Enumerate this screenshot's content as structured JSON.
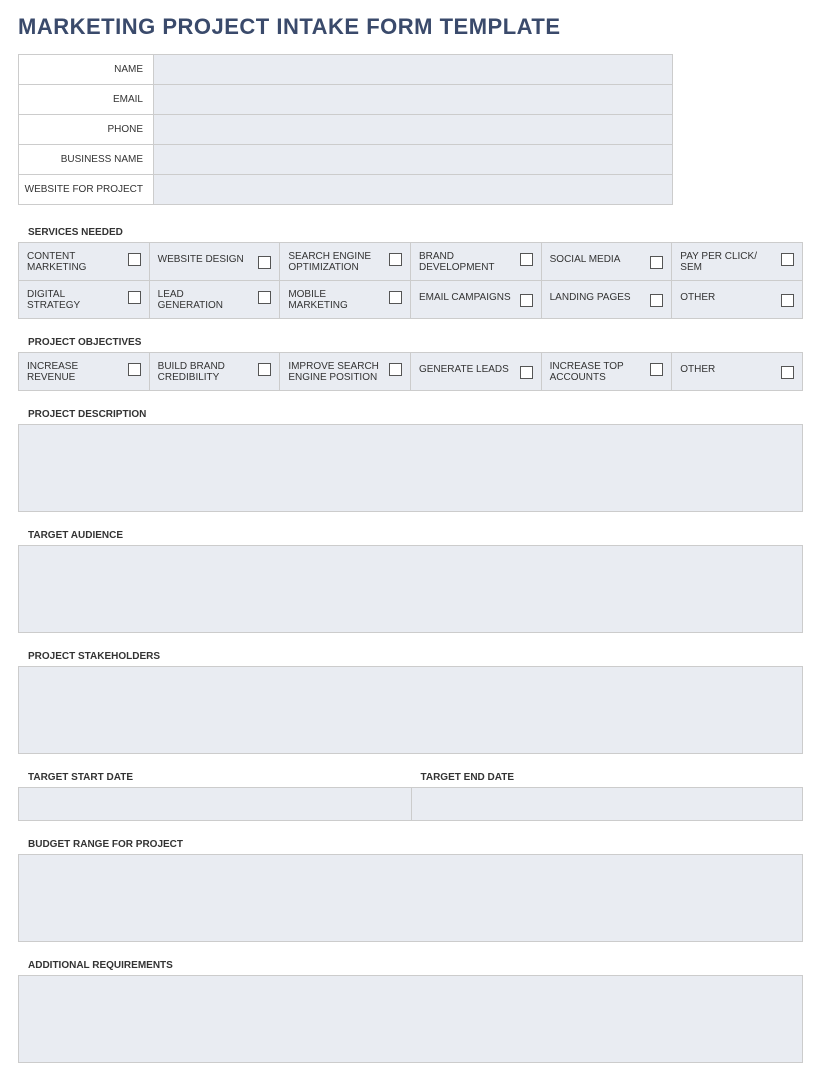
{
  "title": "MARKETING PROJECT INTAKE FORM TEMPLATE",
  "info": {
    "name": {
      "label": "NAME",
      "value": ""
    },
    "email": {
      "label": "EMAIL",
      "value": ""
    },
    "phone": {
      "label": "PHONE",
      "value": ""
    },
    "business_name": {
      "label": "BUSINESS NAME",
      "value": ""
    },
    "website": {
      "label": "WEBSITE FOR PROJECT",
      "value": ""
    }
  },
  "services": {
    "header": "SERVICES NEEDED",
    "row1": [
      "CONTENT MARKETING",
      "WEBSITE DESIGN",
      "SEARCH ENGINE OPTIMIZATION",
      "BRAND DEVELOPMENT",
      "SOCIAL MEDIA",
      "PAY PER CLICK/ SEM"
    ],
    "row2": [
      "DIGITAL STRATEGY",
      "LEAD GENERATION",
      "MOBILE MARKETING",
      "EMAIL CAMPAIGNS",
      "LANDING PAGES",
      "OTHER"
    ]
  },
  "objectives": {
    "header": "PROJECT OBJECTIVES",
    "items": [
      "INCREASE REVENUE",
      "BUILD BRAND CREDIBILITY",
      "IMPROVE SEARCH ENGINE POSITION",
      "GENERATE LEADS",
      "INCREASE TOP ACCOUNTS",
      "OTHER"
    ]
  },
  "description": {
    "header": "PROJECT DESCRIPTION",
    "value": ""
  },
  "audience": {
    "header": "TARGET AUDIENCE",
    "value": ""
  },
  "stakeholders": {
    "header": "PROJECT STAKEHOLDERS",
    "value": ""
  },
  "start_date": {
    "header": "TARGET START DATE",
    "value": ""
  },
  "end_date": {
    "header": "TARGET END DATE",
    "value": ""
  },
  "budget": {
    "header": "BUDGET RANGE FOR PROJECT",
    "value": ""
  },
  "additional": {
    "header": "ADDITIONAL REQUIREMENTS",
    "value": ""
  }
}
